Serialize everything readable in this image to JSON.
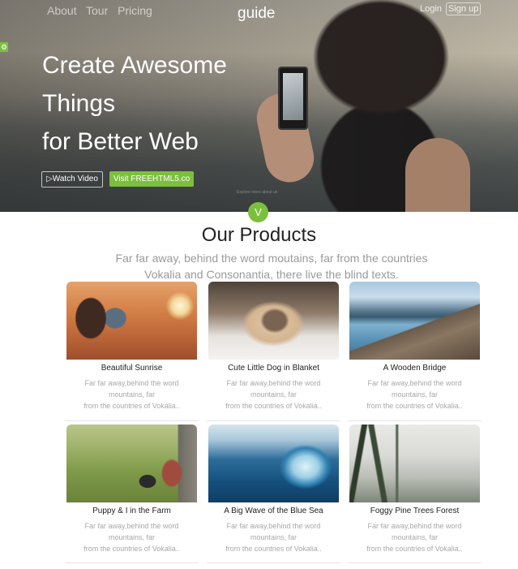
{
  "nav": {
    "links": [
      "About",
      "Tour",
      "Pricing"
    ],
    "brand": "guide",
    "login": "Login",
    "signup": "Sign up"
  },
  "hero": {
    "headline_lines": [
      "Create Awesome",
      "Things",
      "for Better Web"
    ],
    "watch_video": "▷Watch Video",
    "visit": "Visit FREEHTML5.co",
    "explore": "Explore more about us",
    "scroll": "V"
  },
  "products": {
    "title": "Our Products",
    "desc": "Far far away, behind the word moutains, far from the countries Vokalia and Consonantia, there live the blind texts.",
    "items": [
      {
        "title": "Beautiful Sunrise",
        "desc_lines": [
          "Far far away,behind the word",
          "mountains, far",
          "from the countries of Vokalia.."
        ]
      },
      {
        "title": "Cute Little Dog in Blanket",
        "desc_lines": [
          "Far far away,behind the word",
          "mountains, far",
          "from the countries of Vokalia.."
        ]
      },
      {
        "title": "A Wooden Bridge",
        "desc_lines": [
          "Far far away,behind the word",
          "mountains, far",
          "from the countries of Vokalia.."
        ]
      },
      {
        "title": "Puppy & I in the Farm",
        "desc_lines": [
          "Far far away,behind the word",
          "mountains, far",
          "from the countries of Vokalia.."
        ]
      },
      {
        "title": "A Big Wave of the Blue Sea",
        "desc_lines": [
          "Far far away,behind the word",
          "mountains, far",
          "from the countries of Vokalia.."
        ]
      },
      {
        "title": "Foggy Pine Trees Forest",
        "desc_lines": [
          "Far far away,behind the word",
          "mountains, far",
          "from the countries of Vokalia.."
        ]
      }
    ]
  },
  "colors": {
    "accent": "#7cbf3d"
  }
}
